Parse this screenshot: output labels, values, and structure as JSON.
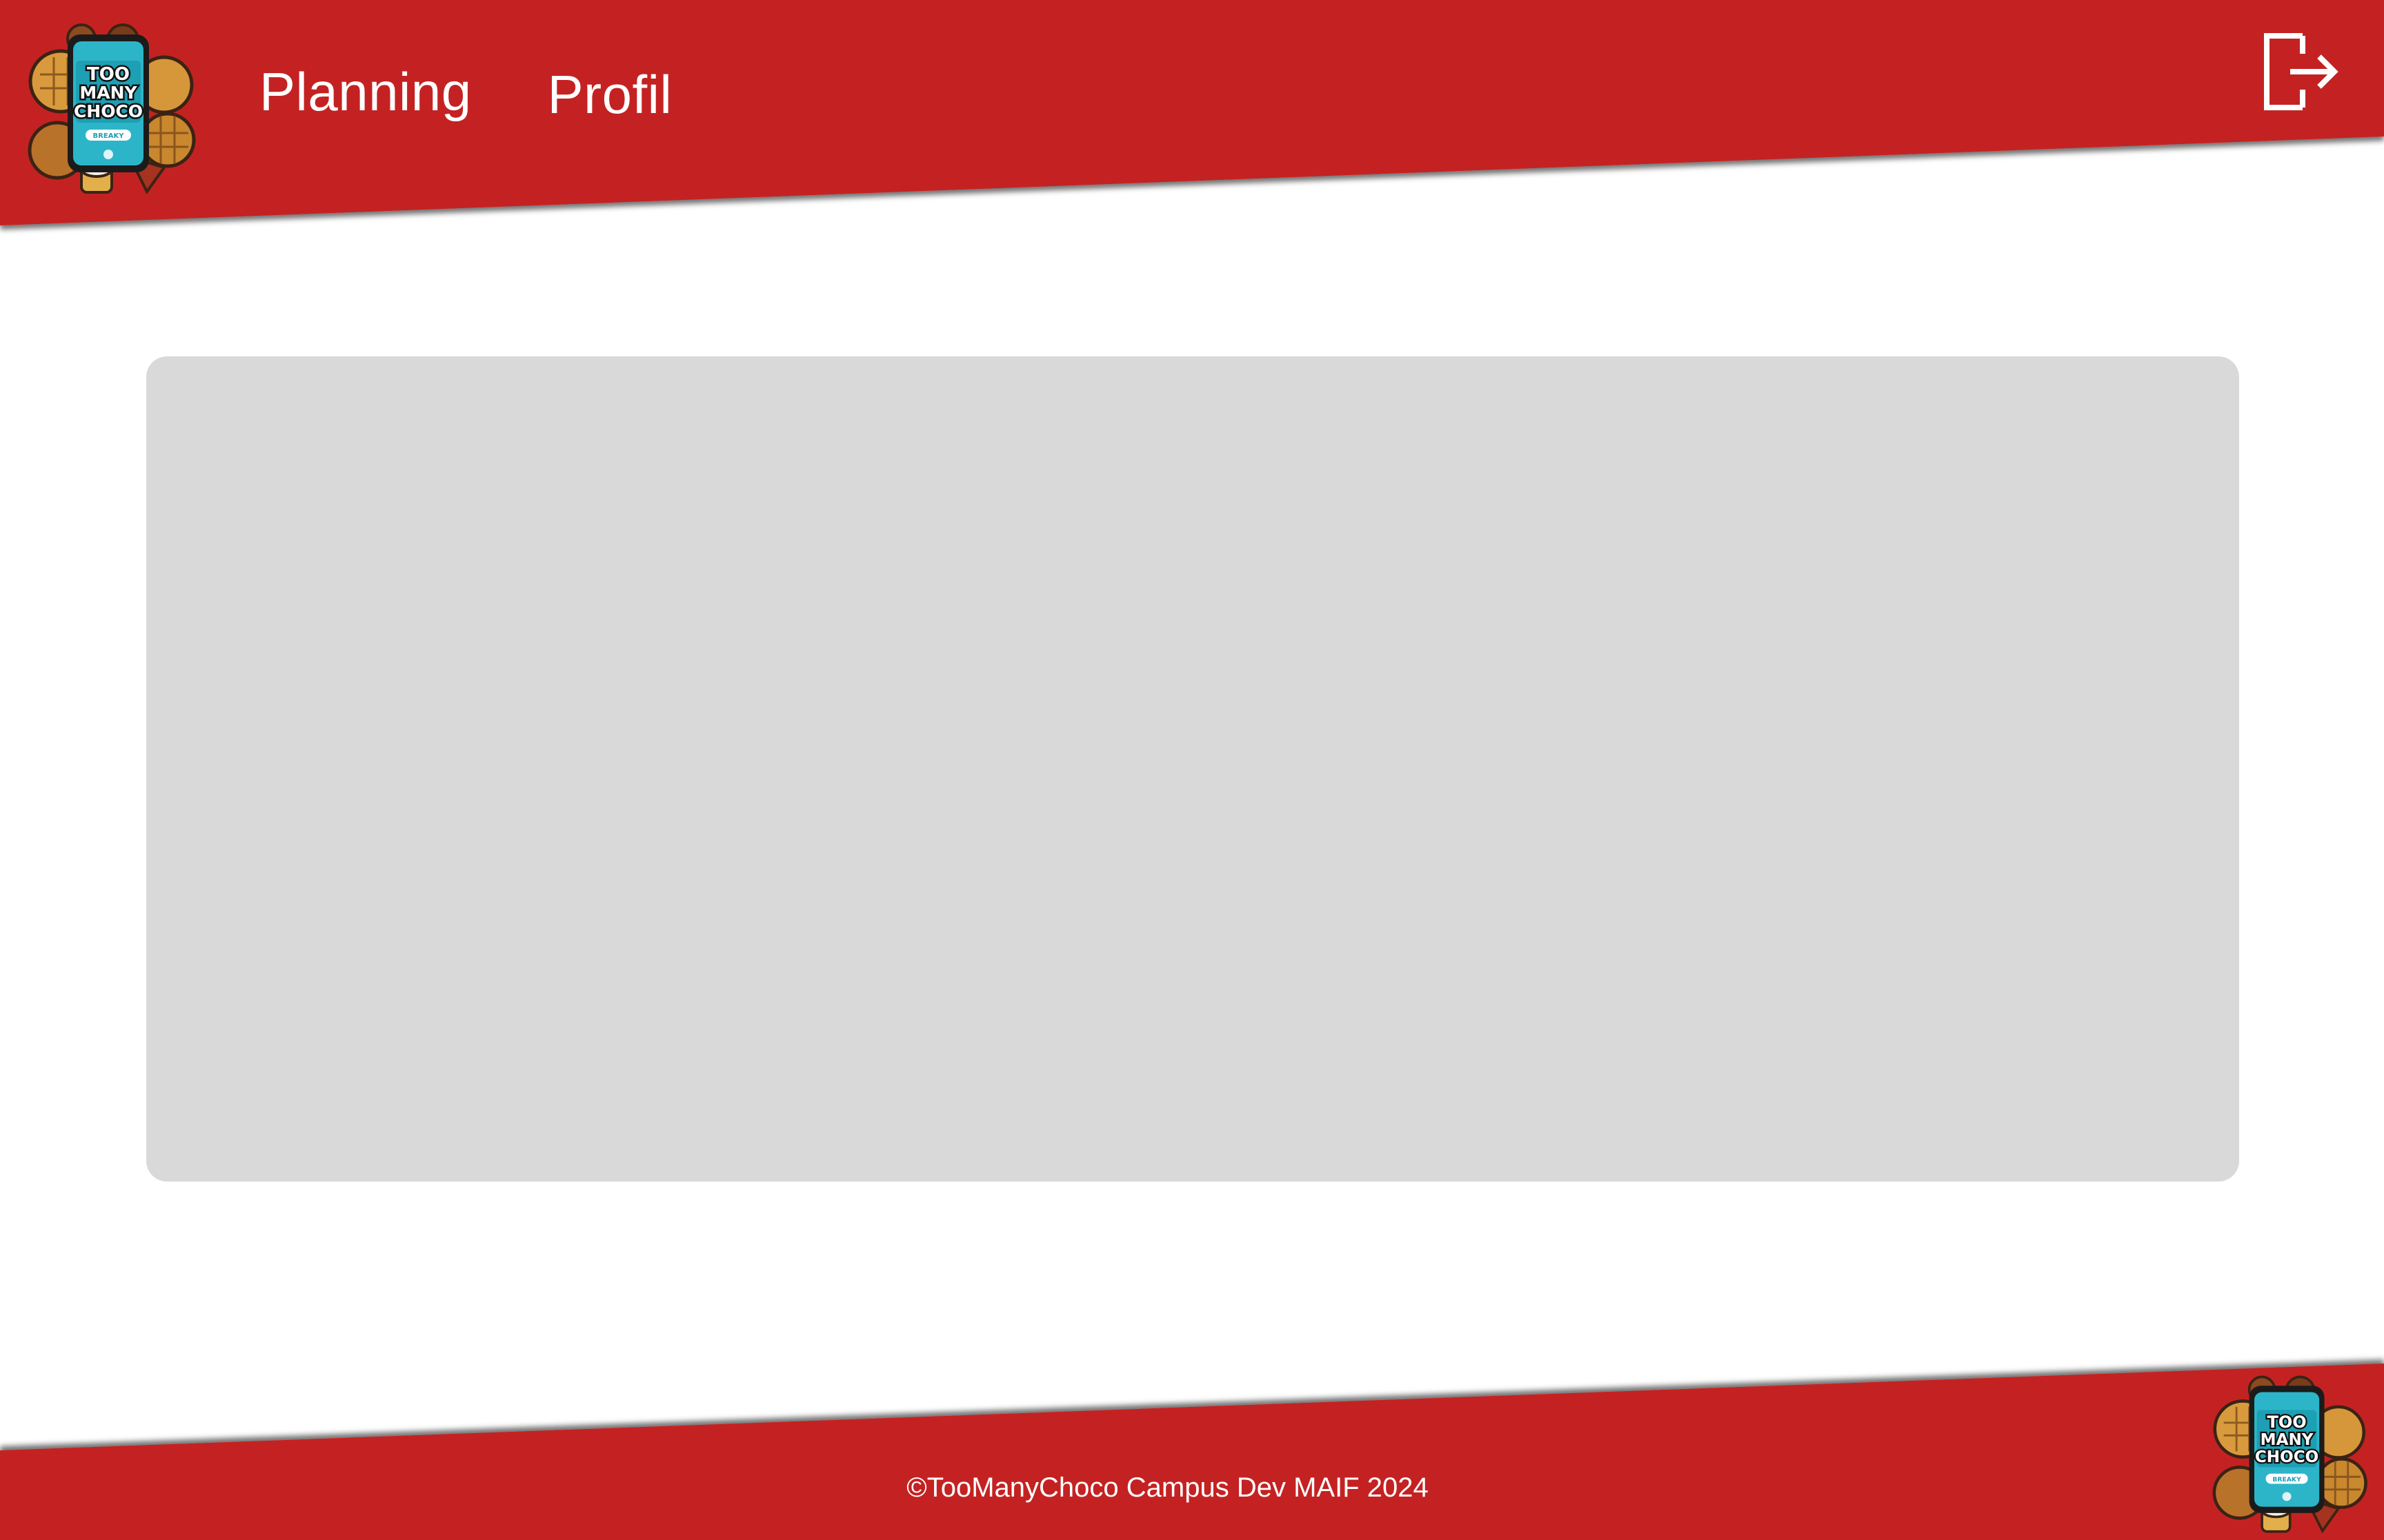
{
  "header": {
    "nav": [
      {
        "label": "Planning"
      },
      {
        "label": "Profil"
      }
    ],
    "logout_icon": "logout-icon",
    "logo_icon": "toomanychoco-logo",
    "logo_lines": [
      "TOO",
      "MANY",
      "CHOCO"
    ],
    "logo_button_text": "BREAKY"
  },
  "main": {
    "panel_color": "#d9d9d9"
  },
  "footer": {
    "copyright": "©TooManyChoco Campus Dev MAIF 2024"
  },
  "colors": {
    "brand_red": "#c42021",
    "white": "#ffffff",
    "panel_grey": "#d9d9d9"
  }
}
